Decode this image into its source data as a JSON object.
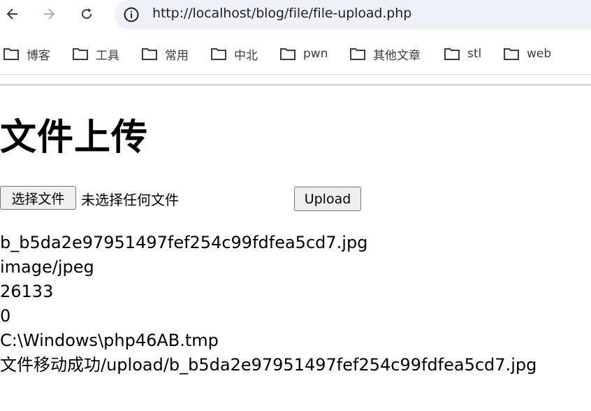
{
  "browser": {
    "url": "http://localhost/blog/file/file-upload.php",
    "icons": {
      "back": "arrow-left-icon",
      "forward": "arrow-right-icon",
      "reload": "reload-icon",
      "site_info": "info-icon"
    }
  },
  "bookmarks": [
    {
      "label": "博客",
      "icon": "folder-icon"
    },
    {
      "label": "工具",
      "icon": "folder-icon"
    },
    {
      "label": "常用",
      "icon": "folder-icon"
    },
    {
      "label": "中北",
      "icon": "folder-icon"
    },
    {
      "label": "pwn",
      "icon": "folder-icon"
    },
    {
      "label": "其他文章",
      "icon": "folder-icon"
    },
    {
      "label": "stl",
      "icon": "folder-icon"
    },
    {
      "label": "web",
      "icon": "folder-icon"
    }
  ],
  "page": {
    "title": "文件上传",
    "file_button_label": "选择文件",
    "file_status": "未选择任何文件",
    "upload_button_label": "Upload",
    "output_lines": [
      "b_b5da2e97951497fef254c99fdfea5cd7.jpg",
      "image/jpeg",
      "26133",
      "0",
      "C:\\Windows\\php46AB.tmp",
      "文件移动成功/upload/b_b5da2e97951497fef254c99fdfea5cd7.jpg"
    ]
  }
}
